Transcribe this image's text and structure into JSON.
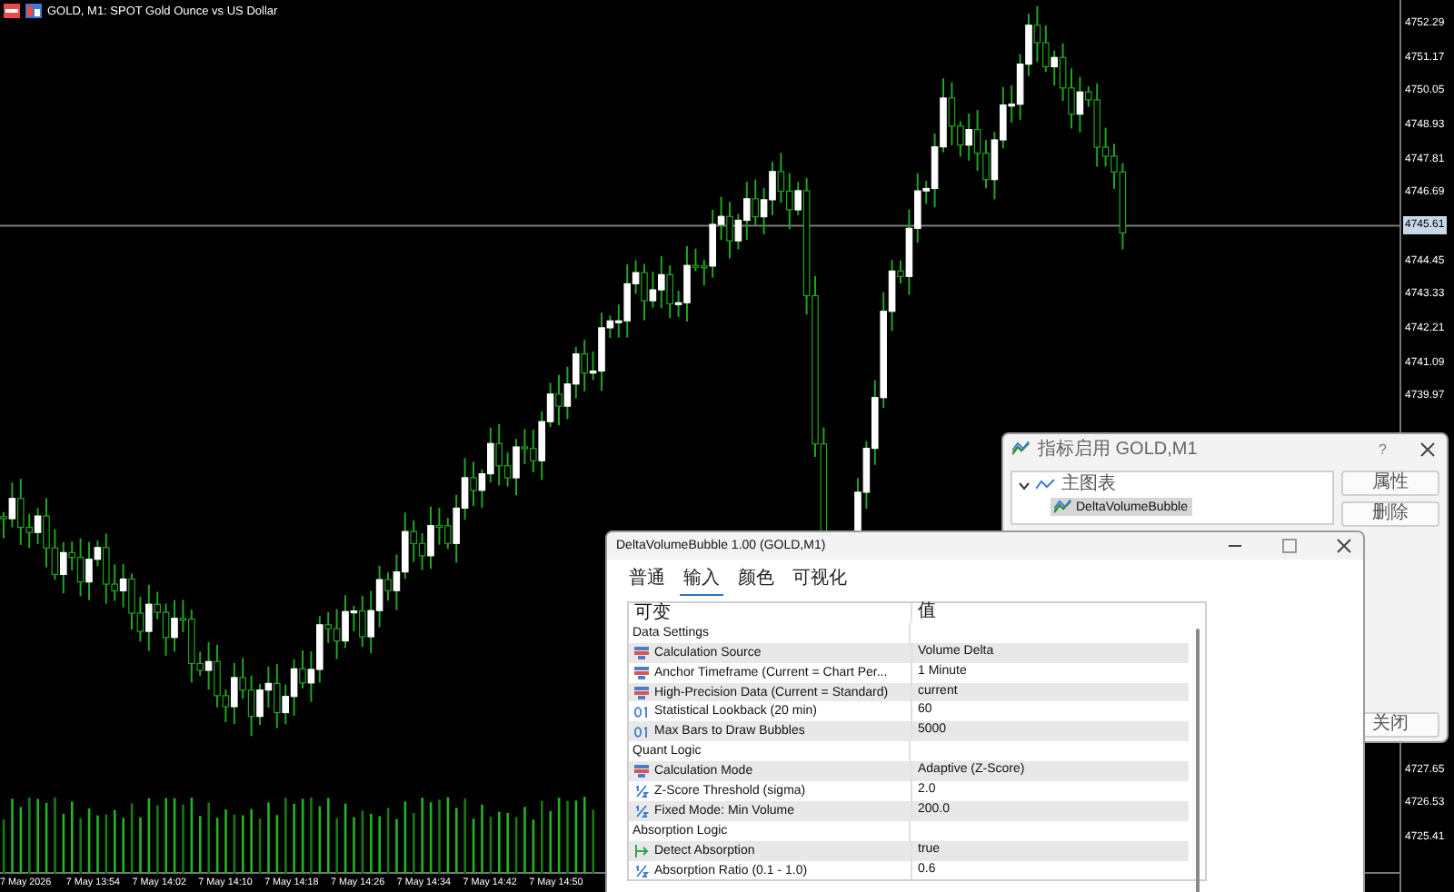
{
  "chart": {
    "title": "GOLD, M1:  SPOT Gold Ounce vs US Dollar",
    "price_labels": [
      "4752.29",
      "4751.17",
      "4750.05",
      "4748.93",
      "4747.81",
      "4746.69",
      "4744.45",
      "4743.33",
      "4742.21",
      "4741.09",
      "4739.97",
      "4727.65",
      "4726.53",
      "4725.41"
    ],
    "current_price": "4745.61",
    "time_labels": [
      "7 May 2026",
      "7 May 13:54",
      "7 May 14:02",
      "7 May 14:10",
      "7 May 14:18",
      "7 May 14:26",
      "7 May 14:34",
      "7 May 14:42",
      "7 May 14:50"
    ]
  },
  "indicators_dialog": {
    "title": "指标启用 GOLD,M1",
    "help": "?",
    "tree": [
      {
        "label": "主图表",
        "expanded": true,
        "children": [
          {
            "label": "DeltaVolumeBubble",
            "selected": true
          }
        ]
      }
    ],
    "buttons": [
      "属性",
      "删除",
      "关闭"
    ]
  },
  "properties_dialog": {
    "title": "DeltaVolumeBubble 1.00 (GOLD,M1)",
    "tabs": [
      {
        "label": "普通",
        "selected": false
      },
      {
        "label": "输入",
        "selected": true
      },
      {
        "label": "颜色",
        "selected": false
      },
      {
        "label": "可视化",
        "selected": false
      }
    ],
    "columns": [
      "可变",
      "值"
    ],
    "rows": [
      {
        "kind": "group",
        "name": "Data Settings"
      },
      {
        "kind": "enum",
        "name": "Calculation Source",
        "value": "Volume Delta"
      },
      {
        "kind": "enum",
        "name": "Anchor Timeframe (Current = Chart Per...",
        "value": "1 Minute"
      },
      {
        "kind": "enum",
        "name": "High-Precision Data (Current = Standard)",
        "value": "current"
      },
      {
        "kind": "int",
        "name": "Statistical Lookback (20 min)",
        "value": "60"
      },
      {
        "kind": "int",
        "name": "Max Bars to Draw Bubbles",
        "value": "5000"
      },
      {
        "kind": "group",
        "name": "Quant Logic"
      },
      {
        "kind": "enum",
        "name": "Calculation Mode",
        "value": "Adaptive (Z-Score)"
      },
      {
        "kind": "double",
        "name": "Z-Score Threshold (sigma)",
        "value": "2.0"
      },
      {
        "kind": "double",
        "name": "Fixed Mode: Min Volume",
        "value": "200.0"
      },
      {
        "kind": "group",
        "name": "Absorption Logic"
      },
      {
        "kind": "bool",
        "name": "Detect Absorption",
        "value": "true"
      },
      {
        "kind": "double",
        "name": "Absorption Ratio (0.1 - 1.0)",
        "value": "0.6"
      }
    ]
  }
}
